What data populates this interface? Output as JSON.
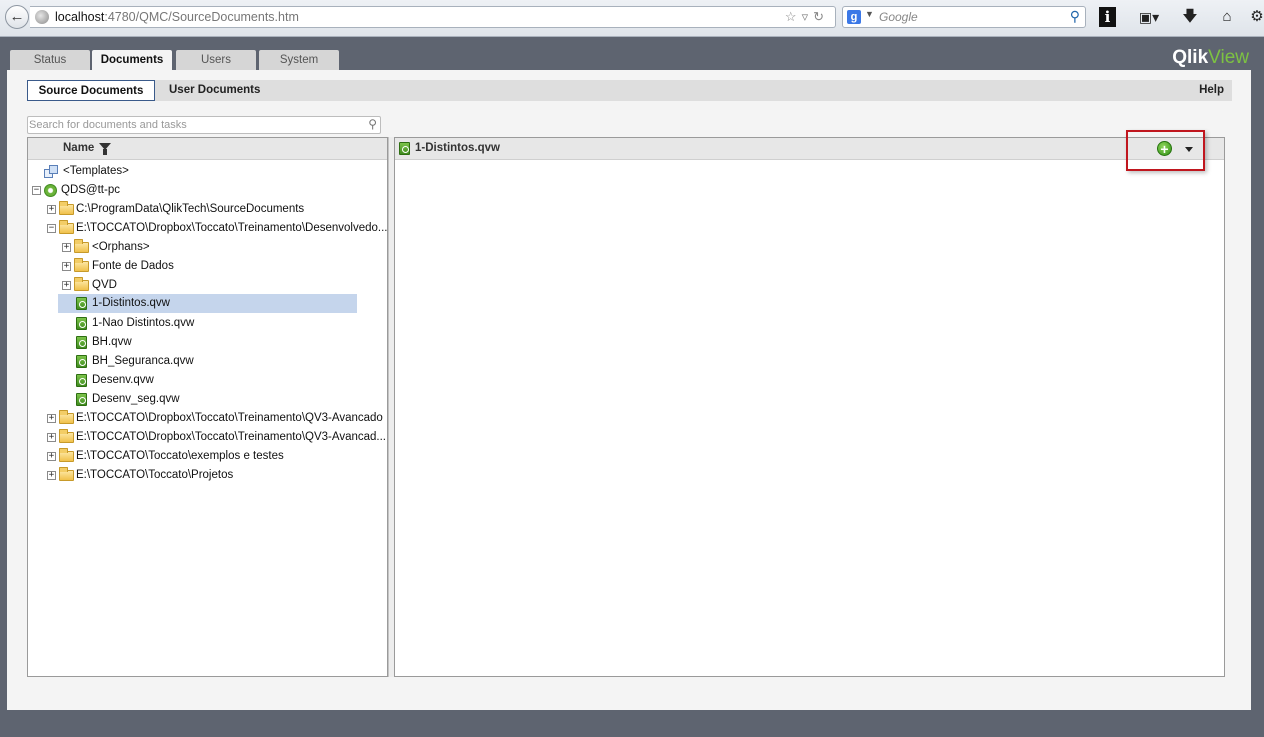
{
  "browser": {
    "url_host": "localhost",
    "url_path": ":4780/QMC/SourceDocuments.htm",
    "search_engine_letter": "g",
    "search_placeholder": "Google",
    "info_label": "i"
  },
  "app": {
    "logo_qlik": "Qlik",
    "logo_view": "View",
    "tabs": [
      {
        "label": "Status"
      },
      {
        "label": "Documents"
      },
      {
        "label": "Users"
      },
      {
        "label": "System"
      }
    ],
    "active_tab": "Documents",
    "subtabs": [
      {
        "label": "Source Documents"
      },
      {
        "label": "User Documents"
      }
    ],
    "help_label": "Help"
  },
  "search": {
    "placeholder": "Search for documents and tasks"
  },
  "tree": {
    "column_header": "Name",
    "rows": [
      {
        "label": "<Templates>"
      },
      {
        "label": "QDS@tt-pc"
      },
      {
        "label": "C:\\ProgramData\\QlikTech\\SourceDocuments"
      },
      {
        "label": "E:\\TOCCATO\\Dropbox\\Toccato\\Treinamento\\Desenvolvedo..."
      },
      {
        "label": "<Orphans>"
      },
      {
        "label": "Fonte de Dados"
      },
      {
        "label": "QVD"
      },
      {
        "label": "1-Distintos.qvw"
      },
      {
        "label": "1-Nao Distintos.qvw"
      },
      {
        "label": "BH.qvw"
      },
      {
        "label": "BH_Seguranca.qvw"
      },
      {
        "label": "Desenv.qvw"
      },
      {
        "label": "Desenv_seg.qvw"
      },
      {
        "label": "E:\\TOCCATO\\Dropbox\\Toccato\\Treinamento\\QV3-Avancado"
      },
      {
        "label": "E:\\TOCCATO\\Dropbox\\Toccato\\Treinamento\\QV3-Avancad..."
      },
      {
        "label": "E:\\TOCCATO\\Toccato\\exemplos e testes"
      },
      {
        "label": "E:\\TOCCATO\\Toccato\\Projetos"
      }
    ],
    "selected": "1-Distintos.qvw"
  },
  "detail": {
    "title": "1-Distintos.qvw",
    "add_symbol": "+"
  },
  "colors": {
    "accent_green": "#7dc242",
    "selection": "#c5d5ec",
    "highlight_red": "#c0161e",
    "frame_bg": "#5e6470"
  }
}
